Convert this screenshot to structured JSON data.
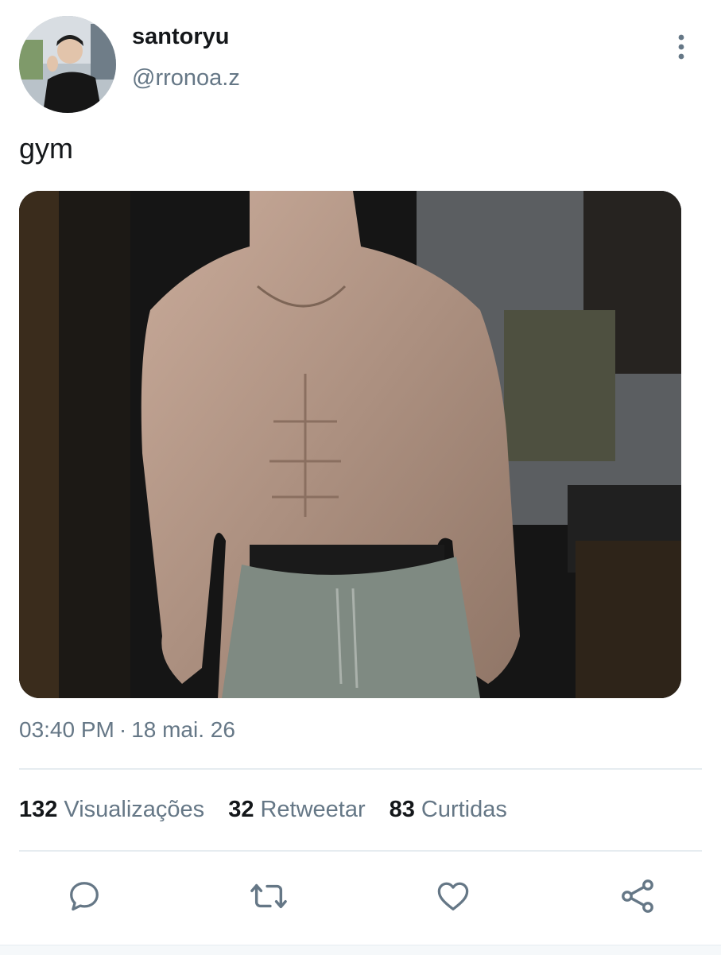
{
  "tweet": {
    "author": {
      "display_name": "santoryu",
      "handle": "@rronoa.z",
      "avatar_icon": "profile-photo"
    },
    "text": "gym",
    "media": {
      "type": "photo",
      "alt_icon": "shirtless-gym-photo"
    },
    "timestamp": {
      "time": "03:40 PM",
      "separator": "·",
      "date": "18 mai. 26"
    },
    "stats": {
      "views": {
        "value": "132",
        "label": "Visualizações"
      },
      "retweets": {
        "value": "32",
        "label": "Retweetar"
      },
      "likes": {
        "value": "83",
        "label": "Curtidas"
      }
    },
    "actions": [
      {
        "name": "reply",
        "icon": "reply-icon"
      },
      {
        "name": "retweet",
        "icon": "retweet-icon"
      },
      {
        "name": "like",
        "icon": "heart-icon"
      },
      {
        "name": "share",
        "icon": "share-icon"
      }
    ]
  },
  "colors": {
    "text_primary": "#14171a",
    "text_secondary": "#657786",
    "icon": "#657786",
    "divider": "#e6ecf0",
    "background": "#ffffff"
  }
}
